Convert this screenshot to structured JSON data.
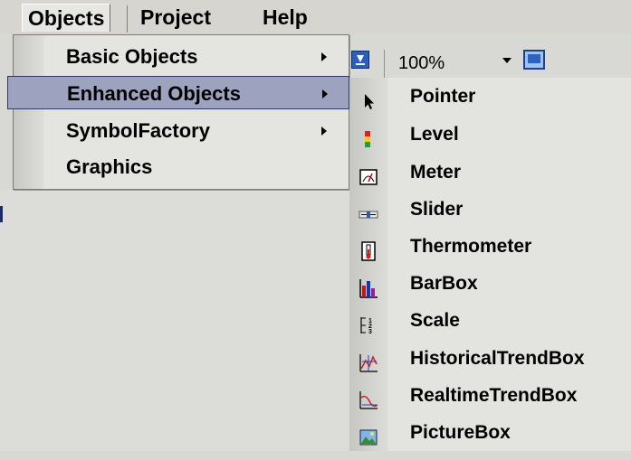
{
  "menubar": {
    "objects": "Objects",
    "project": "Project",
    "help": "Help"
  },
  "toolbar": {
    "zoom": "100%"
  },
  "objects_menu": {
    "items": [
      {
        "label": "Basic Objects",
        "has_submenu": true
      },
      {
        "label": "Enhanced Objects",
        "has_submenu": true,
        "selected": true
      },
      {
        "label": "SymbolFactory",
        "has_submenu": true
      },
      {
        "label": "Graphics",
        "has_submenu": false
      }
    ]
  },
  "enhanced_submenu": {
    "items": [
      {
        "label": "Pointer",
        "icon": "pointer-icon"
      },
      {
        "label": "Level",
        "icon": "level-icon"
      },
      {
        "label": "Meter",
        "icon": "meter-icon"
      },
      {
        "label": "Slider",
        "icon": "slider-icon"
      },
      {
        "label": "Thermometer",
        "icon": "thermometer-icon"
      },
      {
        "label": "BarBox",
        "icon": "barbox-icon"
      },
      {
        "label": "Scale",
        "icon": "scale-icon"
      },
      {
        "label": "HistoricalTrendBox",
        "icon": "historical-trend-icon"
      },
      {
        "label": "RealtimeTrendBox",
        "icon": "realtime-trend-icon"
      },
      {
        "label": "PictureBox",
        "icon": "picture-icon"
      }
    ]
  },
  "colors": {
    "selection": "#9da3bf",
    "selection_border": "#2e3a66",
    "menu_bg": "#e4e4e1"
  }
}
